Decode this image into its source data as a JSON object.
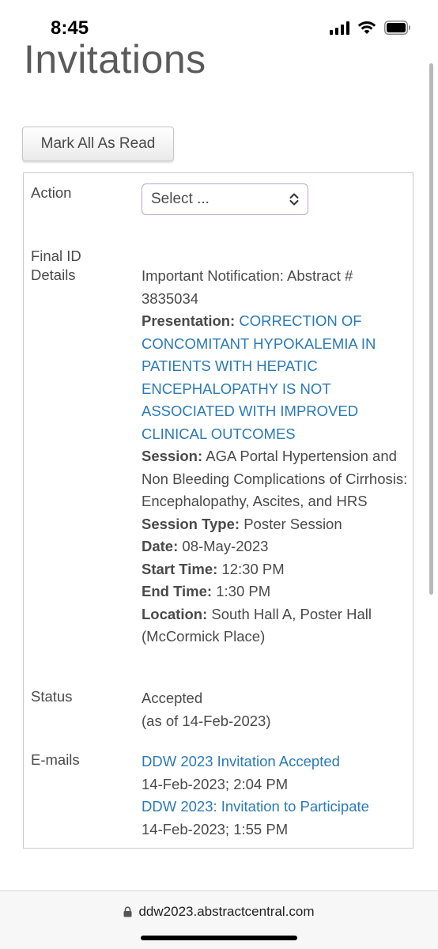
{
  "status_bar": {
    "time": "8:45"
  },
  "page": {
    "title": "Invitations"
  },
  "toolbar": {
    "mark_all_label": "Mark All As Read"
  },
  "invitation": {
    "action": {
      "label": "Action",
      "select_value": "Select ..."
    },
    "final_id": {
      "label_line1": "Final ID",
      "label_line2": "Details",
      "notification": "Important Notification: Abstract # 3835034",
      "presentation_label": "Presentation:",
      "presentation_title_lines": [
        "CORRECTION OF",
        "CONCOMITANT HYPOKALEMIA IN",
        "PATIENTS WITH HEPATIC",
        "ENCEPHALOPATHY IS NOT",
        "ASSOCIATED WITH IMPROVED",
        "CLINICAL OUTCOMES"
      ],
      "session_label": "Session:",
      "session_value": "AGA Portal Hypertension and Non Bleeding Complications of Cirrhosis: Encephalopathy, Ascites, and HRS",
      "session_type_label": "Session Type:",
      "session_type_value": "Poster Session",
      "date_label": "Date:",
      "date_value": "08-May-2023",
      "start_label": "Start Time:",
      "start_value": "12:30 PM",
      "end_label": "End Time:",
      "end_value": "1:30 PM",
      "location_label": "Location:",
      "location_value": "South Hall A, Poster Hall (McCormick Place)"
    },
    "status": {
      "label": "Status",
      "value": "Accepted",
      "as_of": "(as of 14-Feb-2023)"
    },
    "emails": {
      "label": "E-mails",
      "items": [
        {
          "subject": "DDW 2023 Invitation Accepted",
          "timestamp": "14-Feb-2023; 2:04 PM"
        },
        {
          "subject": "DDW 2023: Invitation to Participate",
          "timestamp": "14-Feb-2023; 1:55 PM"
        }
      ]
    }
  },
  "browser": {
    "url": "ddw2023.abstractcentral.com"
  },
  "colors": {
    "link": "#2a7ab8",
    "text": "#4a4a4a",
    "border": "#c9c9c9"
  },
  "icons": {
    "signal": "cellular-signal-icon",
    "wifi": "wifi-icon",
    "battery": "battery-icon",
    "lock": "lock-icon",
    "select": "select-chevron-icon"
  }
}
